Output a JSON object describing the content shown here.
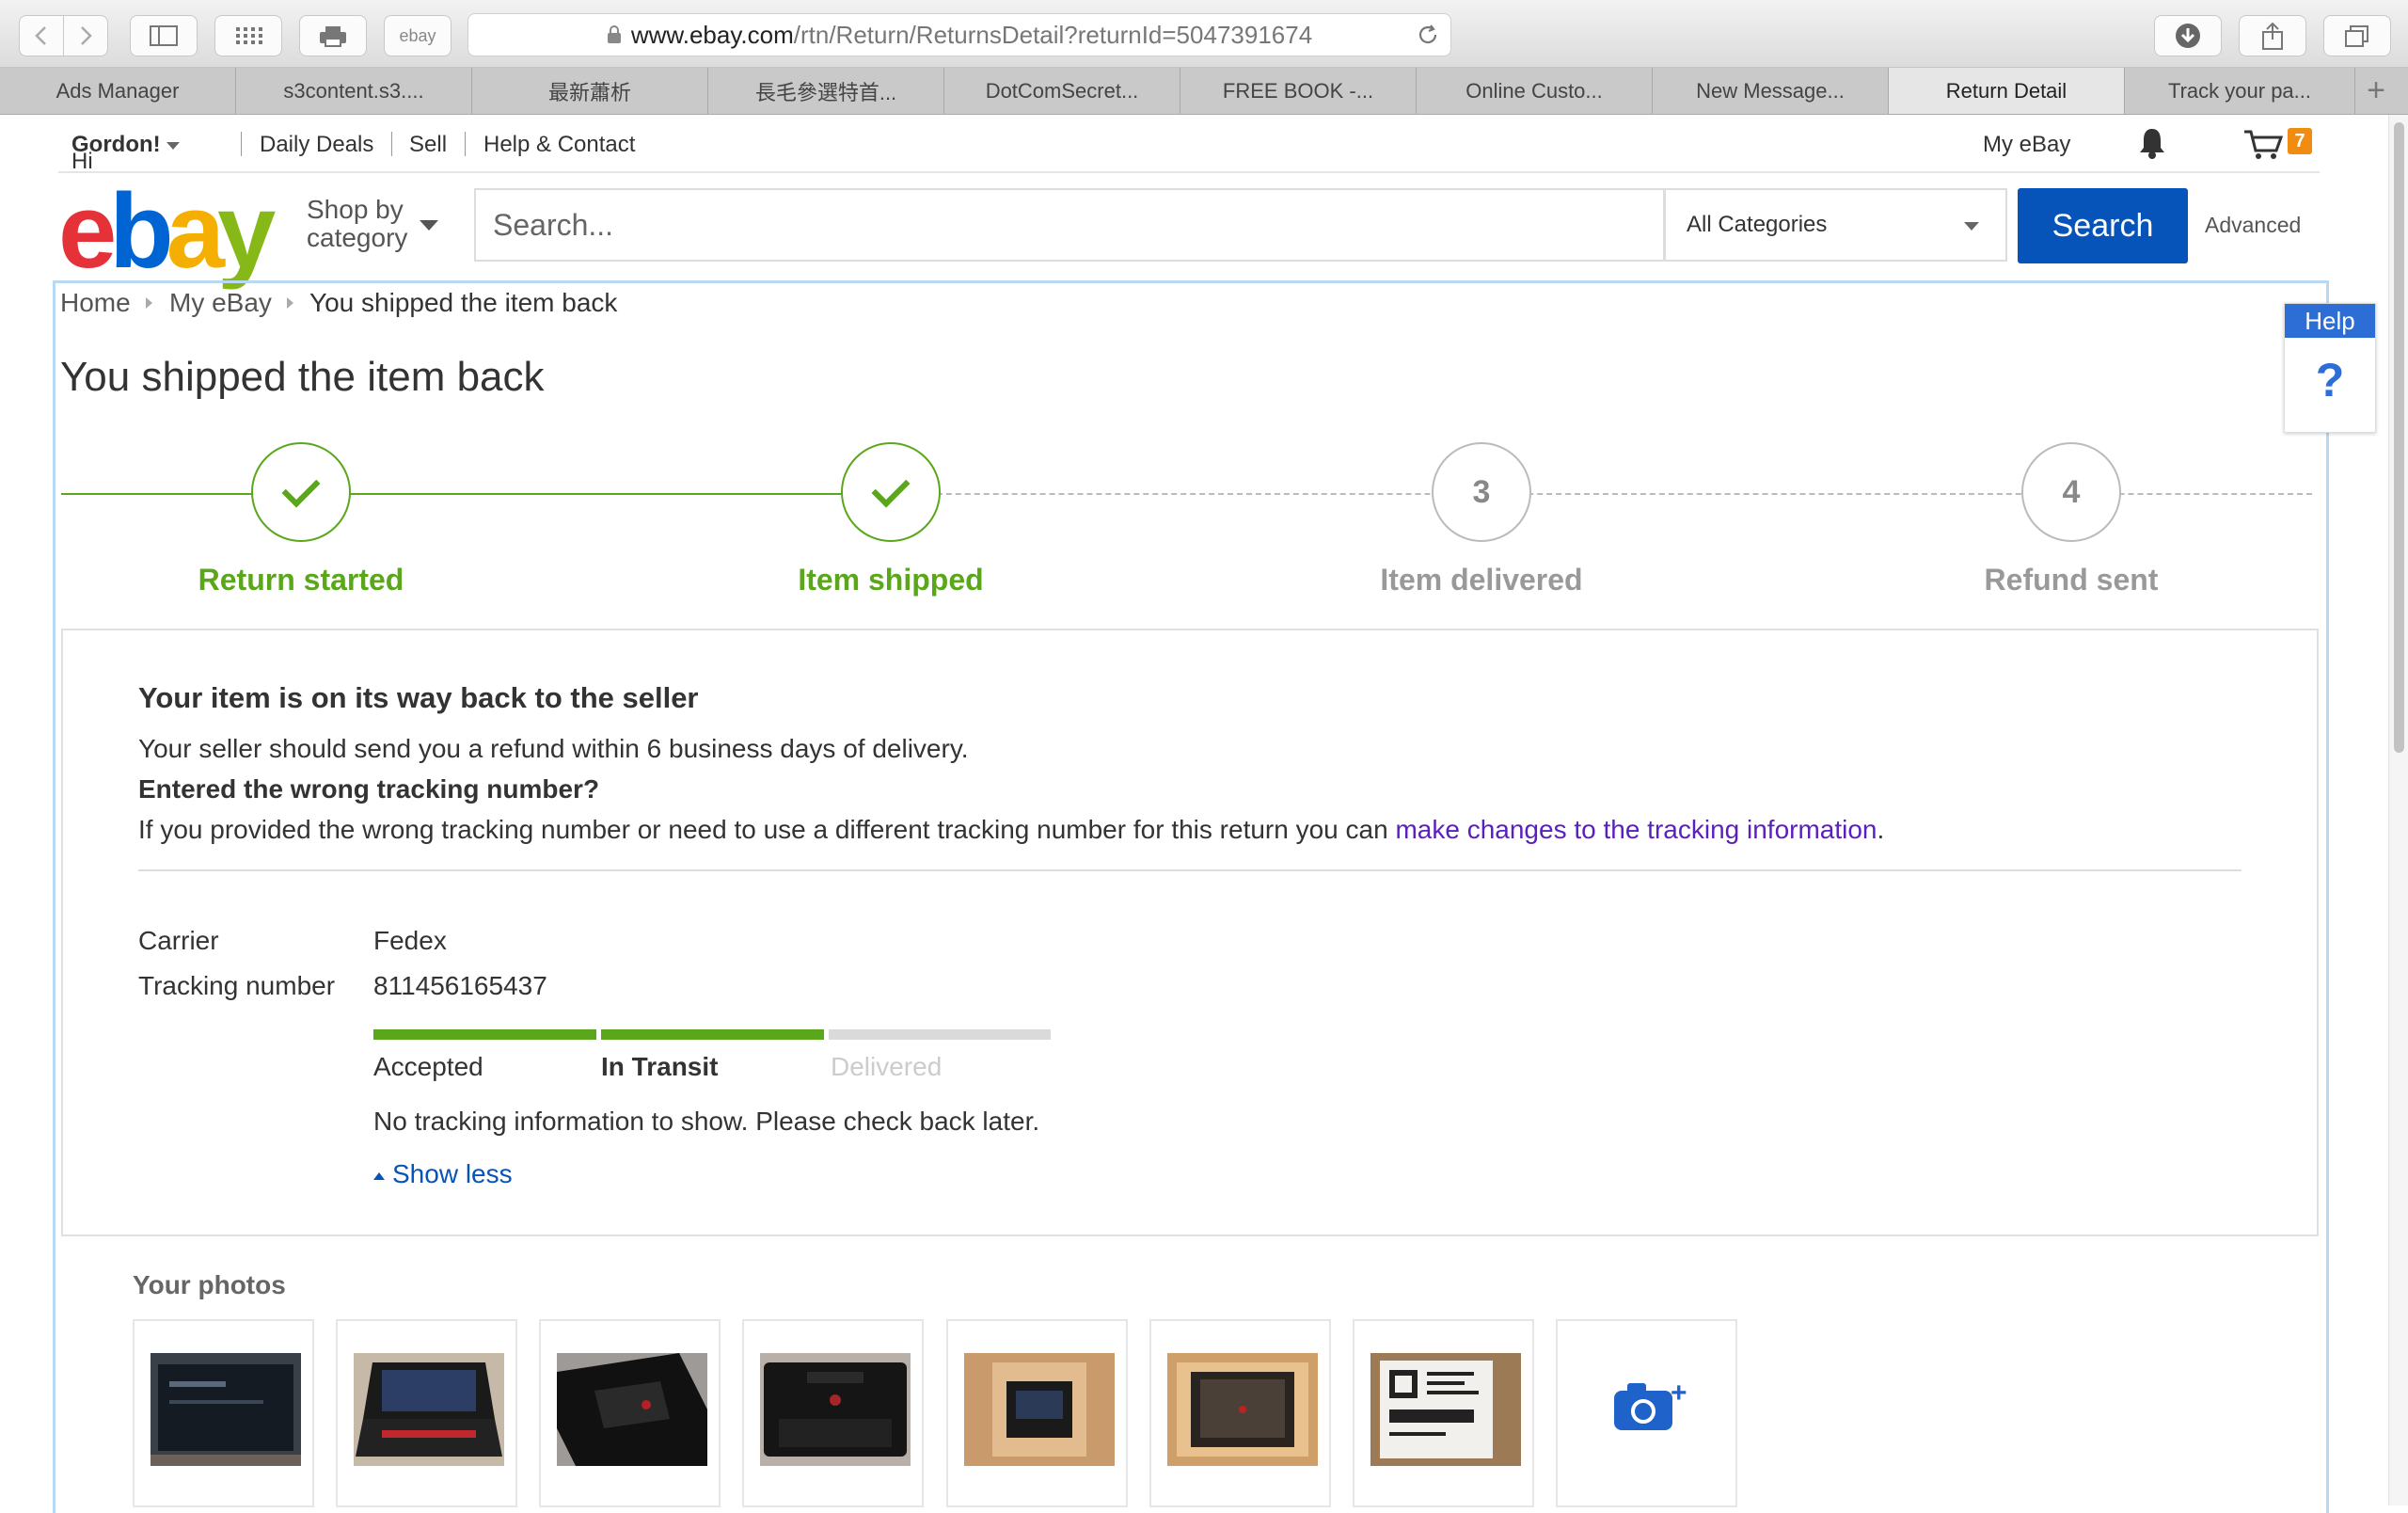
{
  "browser": {
    "url_host": "www.ebay.com",
    "url_path": "/rtn/Return/ReturnsDetail?returnId=5047391674",
    "favicon_label": "ebay"
  },
  "tabs": [
    {
      "label": "Ads Manager",
      "active": false
    },
    {
      "label": "s3content.s3....",
      "active": false
    },
    {
      "label": "最新蕭析",
      "active": false
    },
    {
      "label": "長毛參選特首...",
      "active": false
    },
    {
      "label": "DotComSecret...",
      "active": false
    },
    {
      "label": "FREE BOOK -...",
      "active": false
    },
    {
      "label": "Online Custo...",
      "active": false
    },
    {
      "label": "New Message...",
      "active": false
    },
    {
      "label": "Return Detail",
      "active": true
    },
    {
      "label": "Track your pa...",
      "active": false
    }
  ],
  "topnav": {
    "greeting_prefix": "Hi ",
    "user_name": "Gordon",
    "greeting_suffix": "!",
    "daily_deals": "Daily Deals",
    "sell": "Sell",
    "help_contact": "Help & Contact",
    "my_ebay": "My eBay",
    "cart_count": "7"
  },
  "header": {
    "logo": {
      "e": "e",
      "b": "b",
      "a": "a",
      "y": "y"
    },
    "shop_by_line1": "Shop by",
    "shop_by_line2": "category",
    "search_placeholder": "Search...",
    "category_selected": "All Categories",
    "search_button": "Search",
    "advanced": "Advanced"
  },
  "breadcrumb": [
    "Home",
    "My eBay",
    "You shipped the item back"
  ],
  "page_title": "You shipped the item back",
  "help_widget": {
    "label": "Help",
    "icon": "?"
  },
  "steps": [
    {
      "label": "Return started",
      "status": "done"
    },
    {
      "label": "Item shipped",
      "status": "done"
    },
    {
      "label": "Item delivered",
      "status": "pending",
      "number": "3"
    },
    {
      "label": "Refund sent",
      "status": "pending",
      "number": "4"
    }
  ],
  "status_card": {
    "heading": "Your item is on its way back to the seller",
    "refund_note": "Your seller should send you a refund within 6 business days of delivery.",
    "wrong_tracking_heading": "Entered the wrong tracking number?",
    "wrong_tracking_text": "If you provided the wrong tracking number or need to use a different tracking number for this return you can ",
    "wrong_tracking_link": "make changes to the tracking information",
    "wrong_tracking_end": ".",
    "carrier_label": "Carrier",
    "carrier_value": "Fedex",
    "tracking_label": "Tracking number",
    "tracking_value": "811456165437",
    "progress_stages": [
      {
        "label": "Accepted",
        "complete": true
      },
      {
        "label": "In Transit",
        "complete": true,
        "current": true
      },
      {
        "label": "Delivered",
        "complete": false
      }
    ],
    "no_info": "No tracking information to show. Please check back later.",
    "show_less": "Show less"
  },
  "photos": {
    "title": "Your photos",
    "count": 7,
    "add_photo_icon": "camera-plus-icon"
  },
  "colors": {
    "step_done": "#5ba71b",
    "step_pending": "#999999",
    "link": "#5a1fbf",
    "search_button": "#0654ba",
    "help_blue": "#2c6ed5",
    "cart_badge": "#f18c12"
  }
}
